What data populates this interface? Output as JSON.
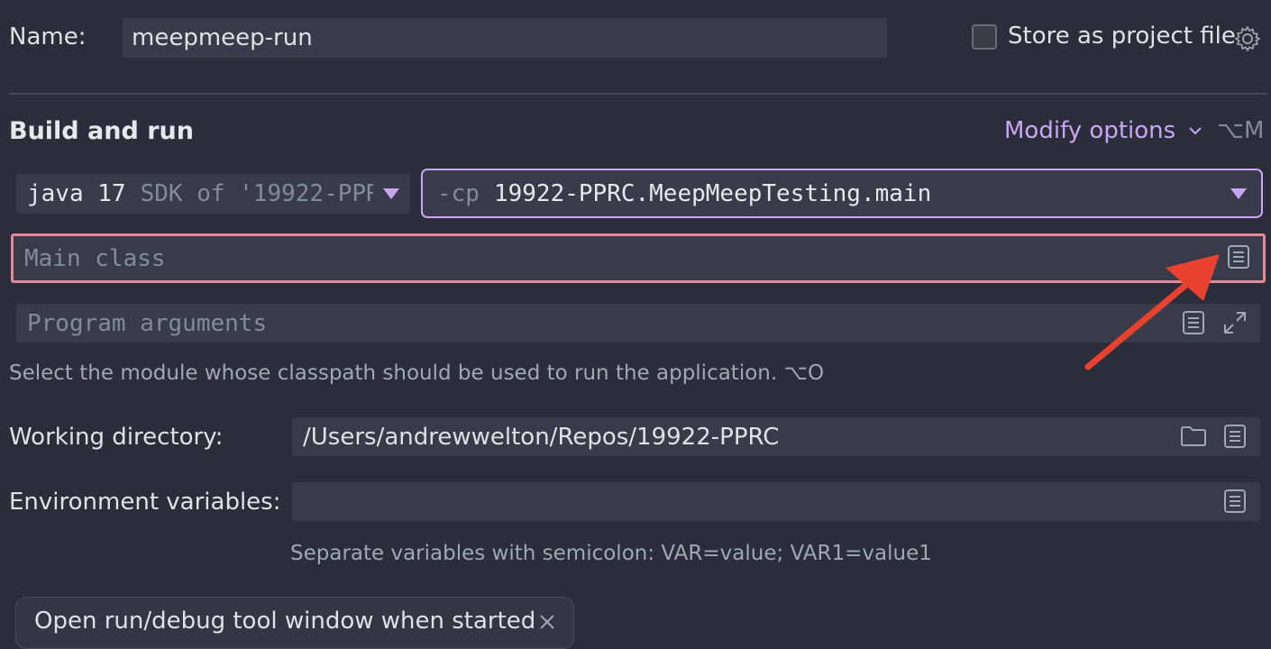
{
  "name": {
    "label": "Name:",
    "value": "meepmeep-run"
  },
  "store": {
    "label": "Store as project file",
    "checked": false
  },
  "build": {
    "title": "Build and run",
    "modify_label": "Modify options",
    "modify_shortcut": "⌥M",
    "sdk_name": "java 17",
    "sdk_detail": "SDK of '19922-PPR",
    "cp_flag": "-cp",
    "cp_value": "19922-PPRC.MeepMeepTesting.main",
    "main_class_placeholder": "Main class",
    "program_args_placeholder": "Program arguments",
    "hint": "Select the module whose classpath should be used to run the application. ⌥O"
  },
  "working_dir": {
    "label": "Working directory:",
    "value": "/Users/andrewwelton/Repos/19922-PPRC"
  },
  "env": {
    "label": "Environment variables:",
    "value": "",
    "hint": "Separate variables with semicolon: VAR=value; VAR1=value1"
  },
  "chip": {
    "label": "Open run/debug tool window when started"
  },
  "colors": {
    "background": "#2b2d3a",
    "field": "#393b4a",
    "accent_purple": "#c8a6f6",
    "error_pink": "#e5889a",
    "annotation_red": "#e8412f"
  }
}
